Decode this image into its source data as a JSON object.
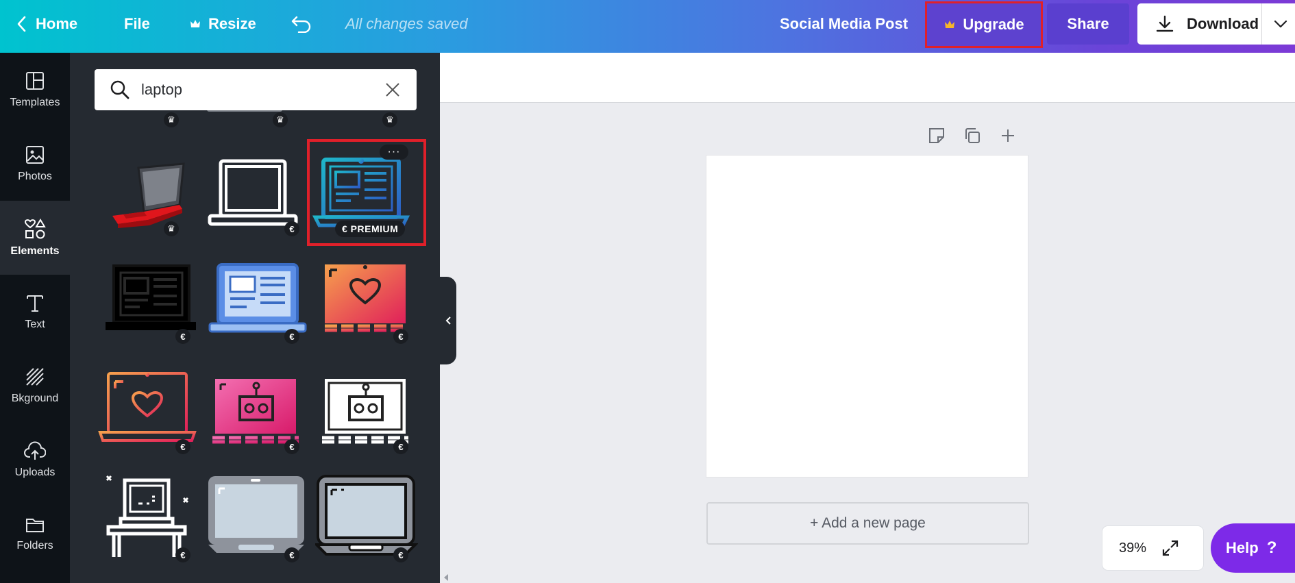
{
  "topbar": {
    "home_label": "Home",
    "file_label": "File",
    "resize_label": "Resize",
    "status_text": "All changes saved",
    "document_name": "Social Media Post",
    "upgrade_label": "Upgrade",
    "share_label": "Share",
    "download_label": "Download"
  },
  "sidebar": {
    "items": [
      {
        "label": "Templates",
        "icon": "templates-icon"
      },
      {
        "label": "Photos",
        "icon": "photos-icon"
      },
      {
        "label": "Elements",
        "icon": "elements-icon",
        "active": true
      },
      {
        "label": "Text",
        "icon": "text-icon"
      },
      {
        "label": "Bkground",
        "icon": "background-icon"
      },
      {
        "label": "Uploads",
        "icon": "uploads-icon"
      },
      {
        "label": "Folders",
        "icon": "folders-icon"
      }
    ]
  },
  "search": {
    "value": "laptop"
  },
  "results": {
    "badge_crown": "♛",
    "badge_euro": "€",
    "premium_label": "€ PREMIUM",
    "more_label": "···",
    "items": [
      {
        "name": "red laptop",
        "badge": "crown"
      },
      {
        "name": "white outline laptop",
        "badge": "euro"
      },
      {
        "name": "blue gradient web laptop",
        "badge": "premium",
        "selected": true
      },
      {
        "name": "black web laptop",
        "badge": "euro"
      },
      {
        "name": "blue web laptop",
        "badge": "euro"
      },
      {
        "name": "orange heart laptop",
        "badge": "euro"
      },
      {
        "name": "orange heart outline laptop",
        "badge": "euro"
      },
      {
        "name": "pink robot laptop",
        "badge": "euro"
      },
      {
        "name": "white robot laptop",
        "badge": "euro"
      },
      {
        "name": "white desk computer",
        "badge": "euro"
      },
      {
        "name": "grey laptop",
        "badge": "euro"
      },
      {
        "name": "dark grey laptop",
        "badge": "euro"
      }
    ]
  },
  "canvas": {
    "add_page_label": "+ Add a new page",
    "zoom_value": "39%",
    "help_label": "Help",
    "help_glyph": "?"
  },
  "colors": {
    "topbar_start": "#00c3cf",
    "topbar_end": "#7c3ad6",
    "highlight": "#e0202a",
    "help_button": "#7d2ae8",
    "panel_bg": "#252a31"
  }
}
